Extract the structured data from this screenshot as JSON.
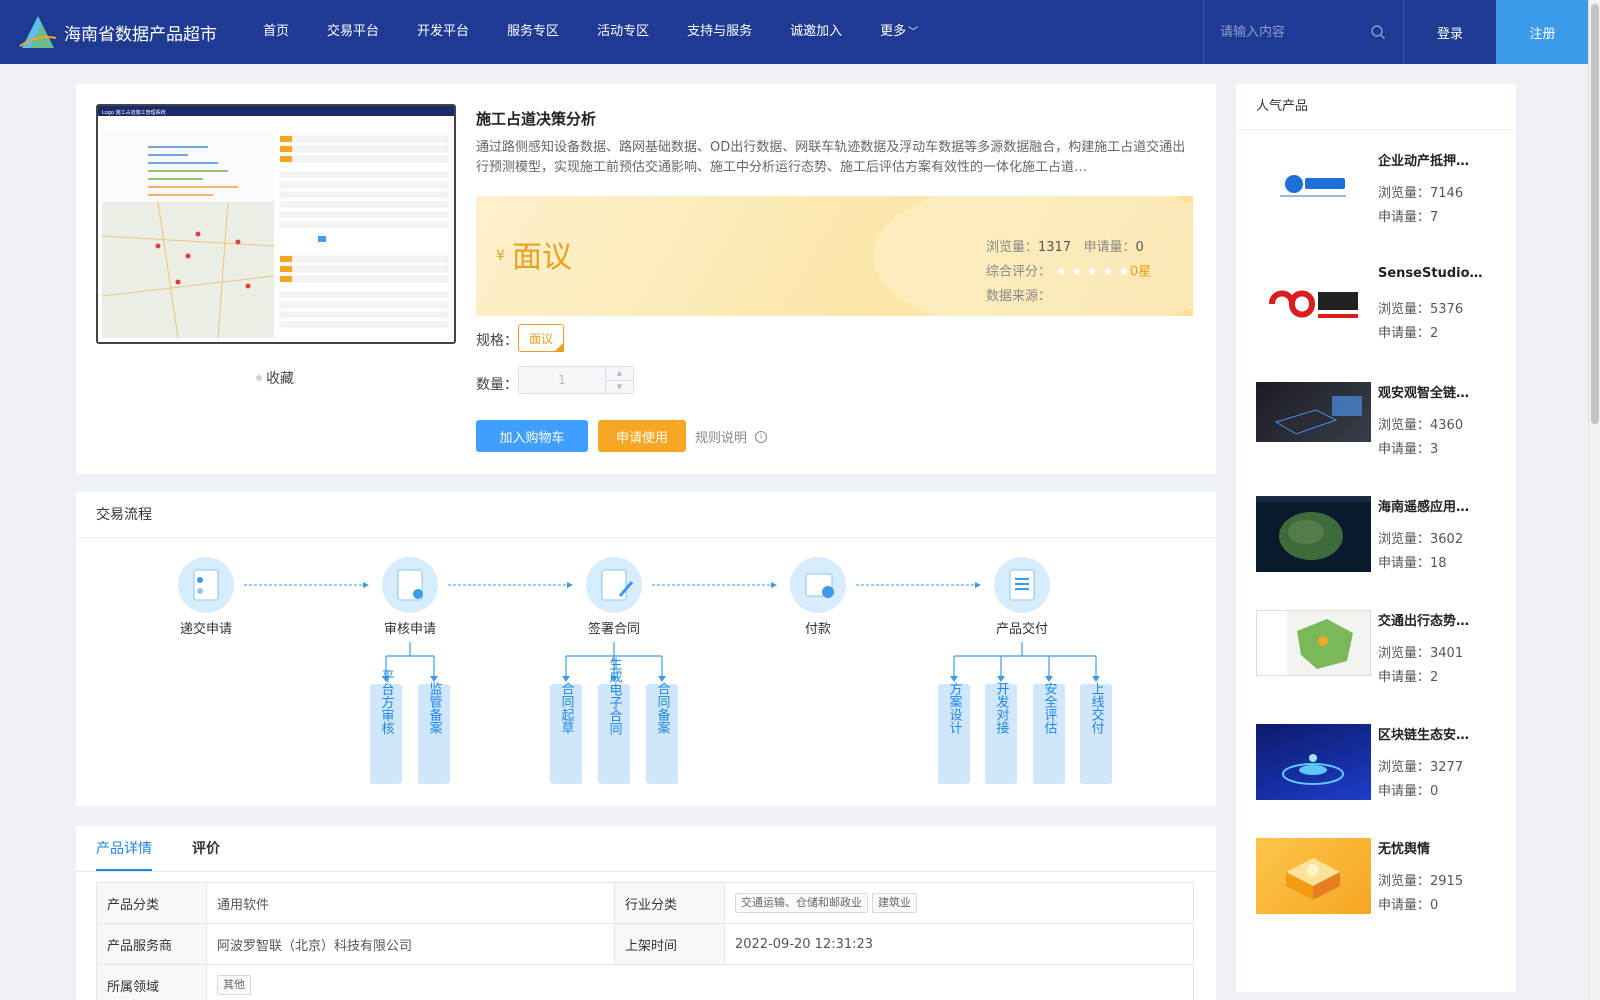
{
  "header": {
    "logo_text": "海南省数据产品超市",
    "nav": [
      "首页",
      "交易平台",
      "开发平台",
      "服务专区",
      "活动专区",
      "支持与服务",
      "诚邀加入"
    ],
    "nav_more": "更多",
    "search_placeholder": "请输入内容",
    "login": "登录",
    "register": "注册"
  },
  "product": {
    "title": "施工占道决策分析",
    "description": "通过路侧感知设备数据、路网基础数据、OD出行数据、网联车轨迹数据及浮动车数据等多源数据融合，构建施工占道交通出行预测模型，实现施工前预估交通影响、施工中分析运行态势、施工后评估方案有效性的一体化施工占道…",
    "currency": "¥",
    "price": "面议",
    "views_label": "浏览量：",
    "views": "1317",
    "apply_label": "申请量：",
    "applies": "0",
    "rating_label": "综合评分：",
    "rating_stars": 0,
    "rating_value": "0星",
    "source_label": "数据来源：",
    "spec_label": "规格：",
    "spec_value": "面议",
    "qty_label": "数量：",
    "qty_value": "1",
    "add_cart": "加入购物车",
    "apply_use": "申请使用",
    "rules": "规则说明",
    "favorite": "收藏"
  },
  "flow": {
    "title": "交易流程",
    "steps": [
      "递交申请",
      "审核申请",
      "签署合同",
      "付款",
      "产品交付"
    ],
    "sub_review": [
      "平台方审核",
      "监管备案"
    ],
    "sub_contract": [
      "合同起草",
      "生成电子合同",
      "合同备案"
    ],
    "sub_delivery": [
      "方案设计",
      "开发对接",
      "安全评估",
      "上线交付"
    ]
  },
  "detail": {
    "tabs": [
      "产品详情",
      "评价"
    ],
    "rows": {
      "category_label": "产品分类",
      "category_value": "通用软件",
      "industry_label": "行业分类",
      "industry_tags": [
        "交通运输、仓储和邮政业",
        "建筑业"
      ],
      "provider_label": "产品服务商",
      "provider_value": "阿波罗智联（北京）科技有限公司",
      "listed_label": "上架时间",
      "listed_value": "2022-09-20 12:31:23",
      "domain_label": "所属领域",
      "domain_tag": "其他"
    }
  },
  "popular": {
    "title": "人气产品",
    "views_label": "浏览量：",
    "apply_label": "申请量：",
    "items": [
      {
        "title": "企业动产抵押…",
        "views": "7146",
        "applies": "7",
        "thumb": "tianyancha-logo"
      },
      {
        "title": "SenseStudio…",
        "views": "5376",
        "applies": "2",
        "thumb": "sensetime-logo"
      },
      {
        "title": "观安观智全链…",
        "views": "4360",
        "applies": "3",
        "thumb": "device-photo"
      },
      {
        "title": "海南遥感应用…",
        "views": "3602",
        "applies": "18",
        "thumb": "island-satellite"
      },
      {
        "title": "交通出行态势…",
        "views": "3401",
        "applies": "2",
        "thumb": "traffic-map"
      },
      {
        "title": "区块链生态安…",
        "views": "3277",
        "applies": "0",
        "thumb": "blockchain-art"
      },
      {
        "title": "无忧舆情",
        "views": "2915",
        "applies": "0",
        "thumb": "orange-box-art"
      }
    ]
  },
  "product_screenshot": {
    "system_title": "Logo  施工占道施工管理系统",
    "search_button": "search"
  },
  "colors": {
    "header_bg": "#1f3a93",
    "register_bg": "#3a9bea",
    "accent_blue": "#409eff",
    "accent_orange": "#f5a623",
    "price_color": "#e8a11c"
  }
}
